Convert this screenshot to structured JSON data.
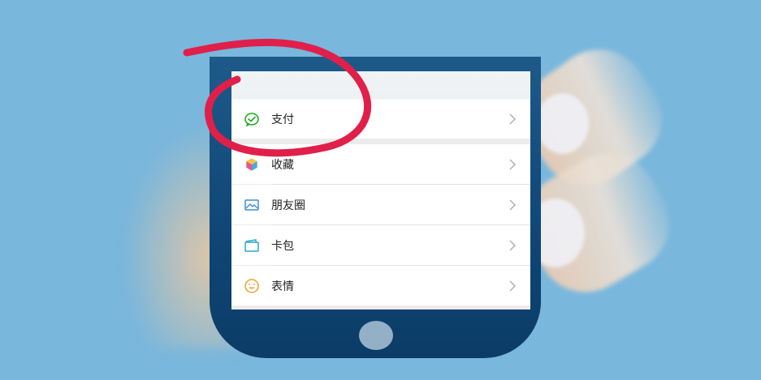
{
  "menu": {
    "items": [
      {
        "label": "支付",
        "icon": "wechat-pay-icon"
      },
      {
        "label": "收藏",
        "icon": "favorites-cube-icon"
      },
      {
        "label": "朋友圈",
        "icon": "moments-picture-icon"
      },
      {
        "label": "卡包",
        "icon": "card-wallet-icon"
      },
      {
        "label": "表情",
        "icon": "sticker-smiley-icon"
      }
    ]
  },
  "colors": {
    "background": "#79b7dc",
    "pay_green": "#1aad19",
    "annotation_red": "#e0204a",
    "phone_body": "#0f4675",
    "chevron": "#b2b2b2"
  }
}
